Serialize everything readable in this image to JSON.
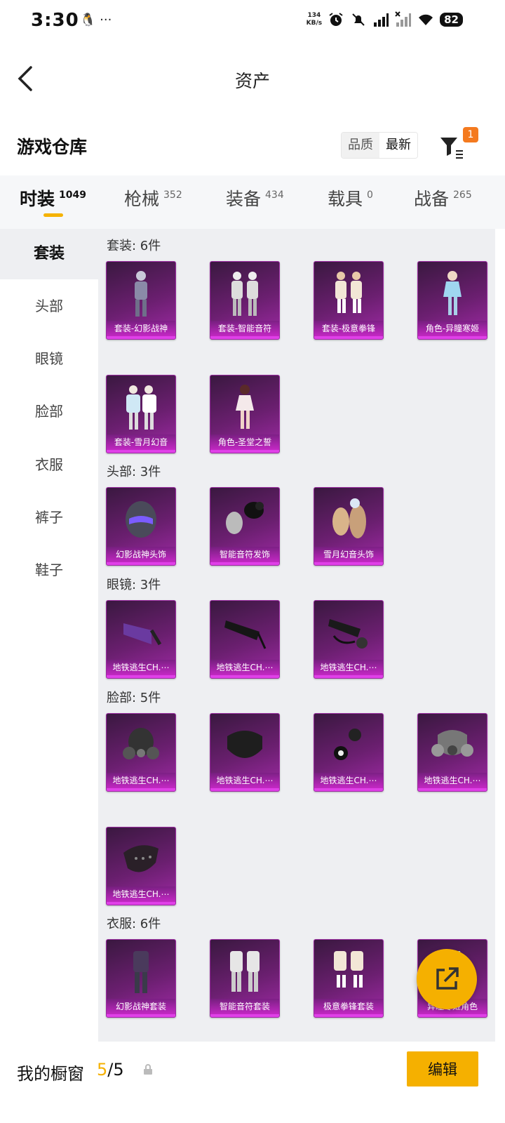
{
  "status_bar": {
    "time": "3:30",
    "left_icons": "🐧 ···",
    "net_speed_value": "134",
    "net_speed_unit": "KB/s",
    "battery": "82"
  },
  "nav": {
    "title": "资产",
    "back_icon": "back-arrow-icon"
  },
  "warehouse": {
    "title": "游戏仓库",
    "sort_quality": "品质",
    "sort_latest": "最新",
    "filter_badge": "1"
  },
  "tabs": [
    {
      "label": "时装",
      "count": "1049"
    },
    {
      "label": "枪械",
      "count": "352"
    },
    {
      "label": "装备",
      "count": "434"
    },
    {
      "label": "载具",
      "count": "0"
    },
    {
      "label": "战备",
      "count": "265"
    }
  ],
  "sidebar": [
    "套装",
    "头部",
    "眼镜",
    "脸部",
    "衣服",
    "裤子",
    "鞋子"
  ],
  "sections": [
    {
      "label": "套装: 6件",
      "items": [
        "套装-幻影战神",
        "套装-智能音符",
        "套装-极意拳锋",
        "角色-异瞳寒姬",
        "套装-雪月幻音",
        "角色-圣堂之誓"
      ]
    },
    {
      "label": "头部: 3件",
      "items": [
        "幻影战神头饰",
        "智能音符发饰",
        "雪月幻音头饰"
      ]
    },
    {
      "label": "眼镜: 3件",
      "items": [
        "地铁逃生CH.⋯",
        "地铁逃生CH.⋯",
        "地铁逃生CH.⋯"
      ]
    },
    {
      "label": "脸部: 5件",
      "items": [
        "地铁逃生CH.⋯",
        "地铁逃生CH.⋯",
        "地铁逃生CH.⋯",
        "地铁逃生CH.⋯",
        "地铁逃生CH.⋯"
      ]
    },
    {
      "label": "衣服: 6件",
      "items": [
        "幻影战神套装",
        "智能音符套装",
        "极意拳锋套装",
        "异瞳寒姬角色"
      ]
    }
  ],
  "bottom": {
    "showcase_label": "我的橱窗",
    "showcase_current": "5",
    "showcase_total": "/5",
    "edit_label": "编辑"
  },
  "colors": {
    "accent": "#f5b000",
    "card_purple": "#6b1f70",
    "badge": "#f47a1f"
  }
}
